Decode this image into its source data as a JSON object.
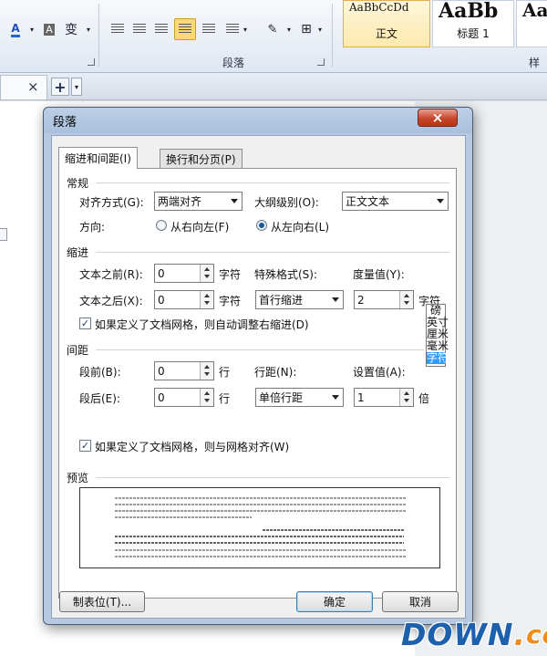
{
  "app": {
    "styles": [
      {
        "sample": "AaBbCcDd",
        "name": "正文"
      },
      {
        "sample": "AaBb",
        "name": "标题 1"
      },
      {
        "sample": "Aa",
        "name": ""
      }
    ],
    "group_label_paragraph": "段落",
    "group_label_styles": "样式",
    "tab_close": "×",
    "tab_add": "+"
  },
  "dialog": {
    "title": "段落",
    "close_glyph": "×",
    "tabs": [
      {
        "label": "缩进和间距(I)",
        "active": true
      },
      {
        "label": "换行和分页(P)",
        "active": false
      }
    ],
    "general": {
      "heading": "常规",
      "alignment_label": "对齐方式(G):",
      "alignment_value": "两端对齐",
      "outline_label": "大纲级别(O):",
      "outline_value": "正文文本",
      "direction_label": "方向:",
      "direction_rtl": "从右向左(F)",
      "direction_ltr": "从左向右(L)",
      "direction_selected": "ltr"
    },
    "indent": {
      "heading": "缩进",
      "before_label": "文本之前(R):",
      "before_value": "0",
      "before_unit": "字符",
      "after_label": "文本之后(X):",
      "after_value": "0",
      "after_unit": "字符",
      "special_label": "特殊格式(S):",
      "special_value": "首行缩进",
      "measure_label": "度量值(Y):",
      "measure_value": "2",
      "measure_unit": "字符",
      "unit_options": [
        "磅",
        "英寸",
        "厘米",
        "毫米",
        "字符"
      ],
      "unit_selected": "字符",
      "auto_adjust_checked": true,
      "auto_adjust_label": "如果定义了文档网格，则自动调整右缩进(D)"
    },
    "spacing": {
      "heading": "间距",
      "before_label": "段前(B):",
      "before_value": "0",
      "before_unit": "行",
      "after_label": "段后(E):",
      "after_value": "0",
      "after_unit": "行",
      "line_label": "行距(N):",
      "line_value": "单倍行距",
      "setting_label": "设置值(A):",
      "setting_value": "1",
      "setting_unit": "倍",
      "snap_grid_checked": true,
      "snap_grid_label": "如果定义了文档网格，则与网格对齐(W)"
    },
    "preview": {
      "heading": "预览"
    },
    "buttons": {
      "tabs": "制表位(T)...",
      "ok": "确定",
      "cancel": "取消"
    }
  },
  "watermark": {
    "main": "DOWN",
    "dot": ".",
    "tld": "cc"
  }
}
